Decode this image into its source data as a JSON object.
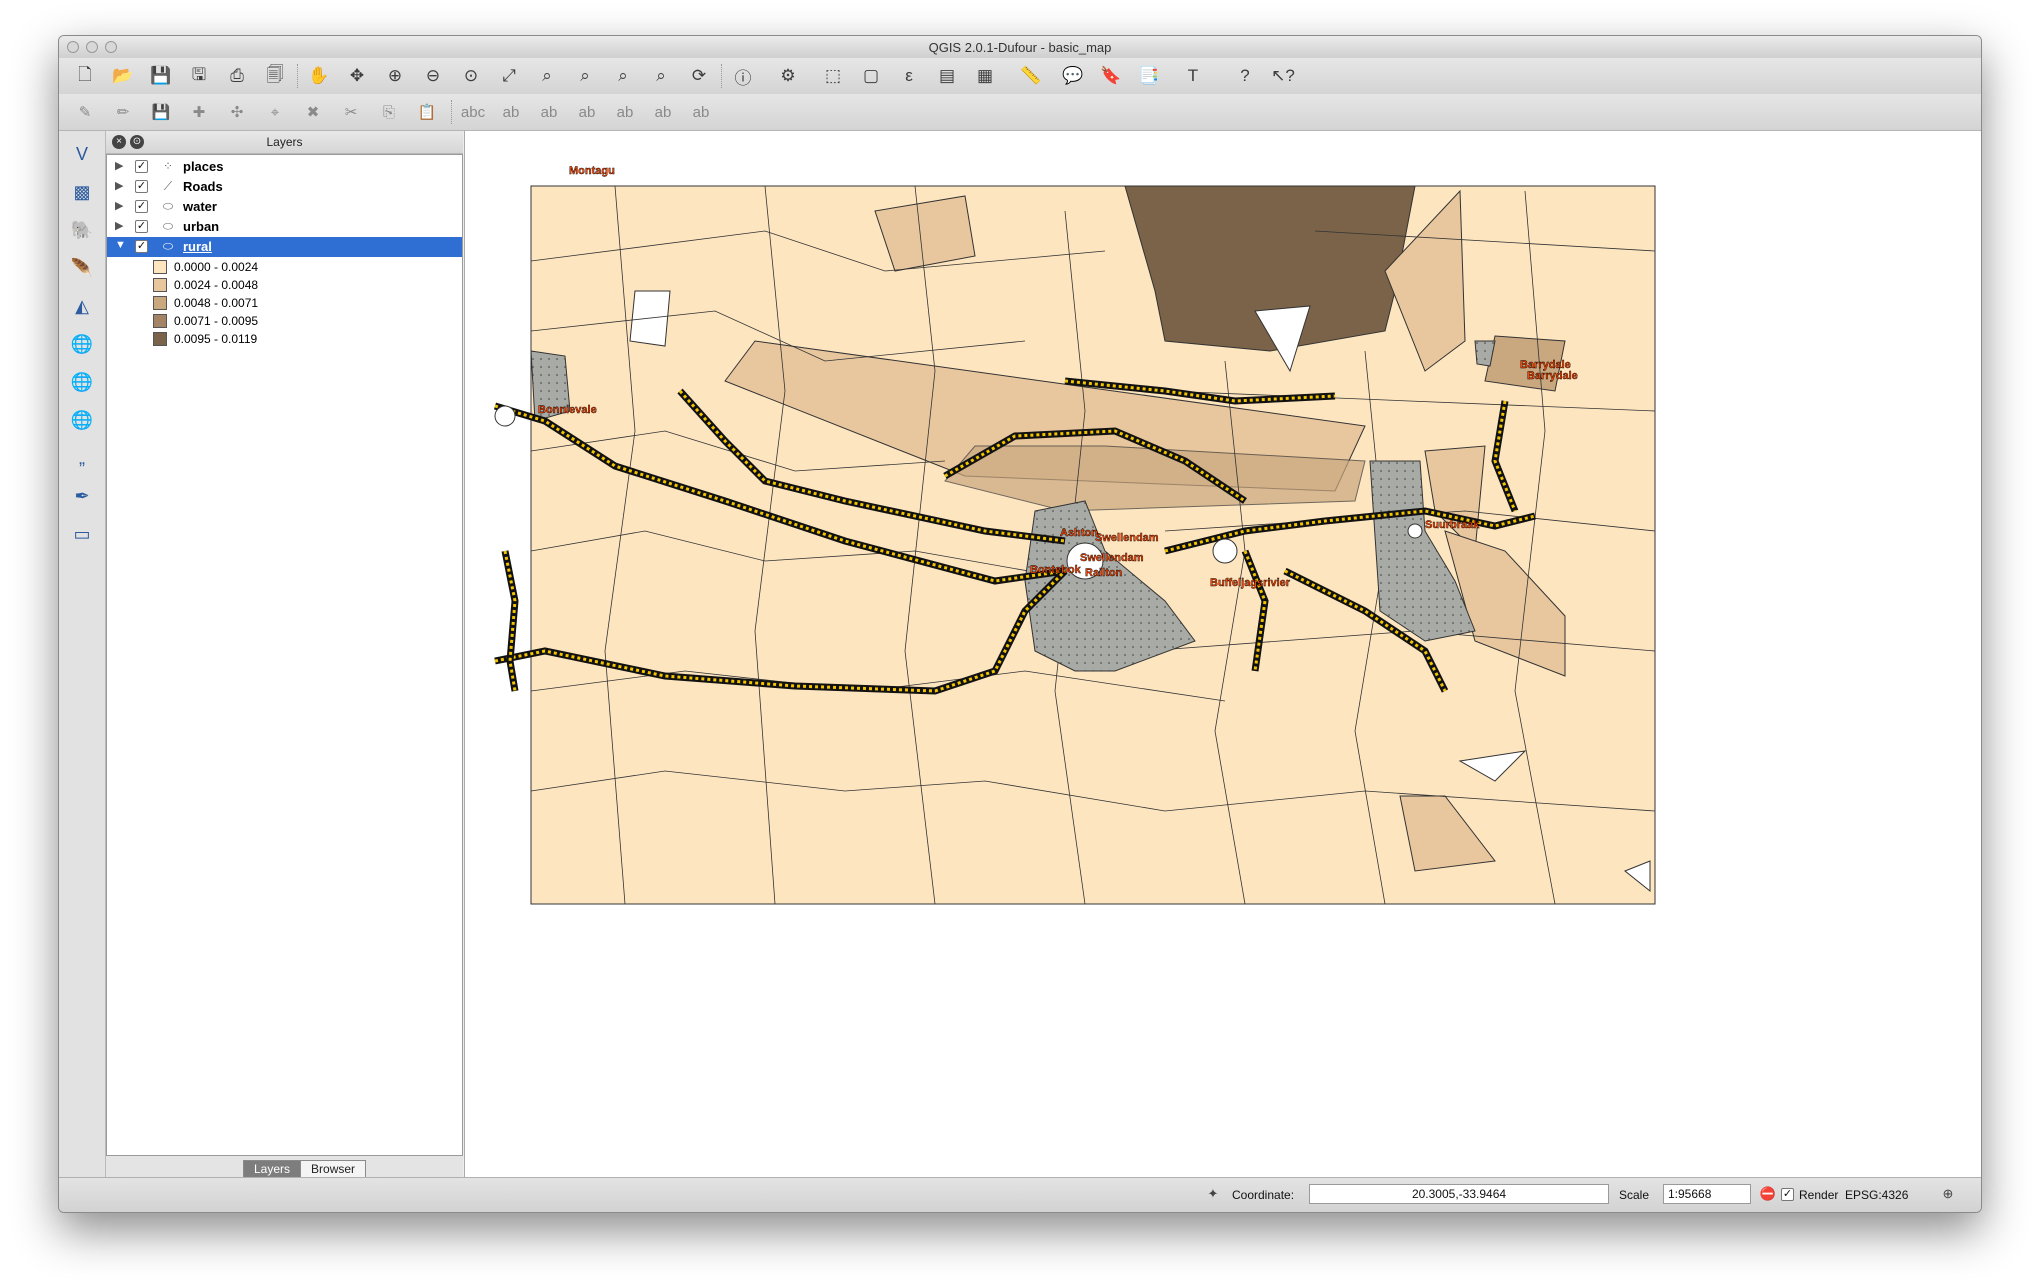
{
  "window": {
    "title": "QGIS 2.0.1-Dufour - basic_map"
  },
  "toolbar_main": {
    "icons": [
      "new-project-icon",
      "open-project-icon",
      "save-project-icon",
      "save-as-icon",
      "new-print-composer-icon",
      "composer-manager-icon",
      "pan-icon",
      "pan-to-selection-icon",
      "zoom-in-icon",
      "zoom-out-icon",
      "zoom-actual-size-icon",
      "zoom-full-icon",
      "zoom-to-selection-icon",
      "zoom-to-layer-icon",
      "zoom-last-icon",
      "zoom-next-icon",
      "refresh-icon",
      "identify-icon",
      "action-icon",
      "select-icon",
      "deselect-icon",
      "field-calculator-icon",
      "attribute-table-icon",
      "statistics-icon",
      "measure-icon",
      "map-tips-icon",
      "new-bookmark-icon",
      "show-bookmarks-icon",
      "text-annotation-icon",
      "help-icon",
      "whats-this-icon"
    ]
  },
  "toolbar_edit": {
    "icons": [
      "current-edits-icon",
      "toggle-editing-icon",
      "save-edits-icon",
      "add-feature-icon",
      "move-feature-icon",
      "node-tool-icon",
      "delete-selected-icon",
      "cut-features-icon",
      "copy-features-icon",
      "paste-features-icon",
      "label-icon",
      "label-pin-icon",
      "label-highlight-icon",
      "label-show-hide-icon",
      "label-move-icon",
      "label-rotate-icon",
      "label-change-icon"
    ]
  },
  "left_toolbar": {
    "icons": [
      "add-vector-layer-icon",
      "add-raster-layer-icon",
      "add-postgis-layer-icon",
      "add-spatialite-layer-icon",
      "add-mssql-layer-icon",
      "add-wms-layer-icon",
      "add-wcs-layer-icon",
      "add-wfs-layer-icon",
      "add-delimited-text-icon",
      "new-shapefile-icon",
      "remove-layer-icon"
    ]
  },
  "layers_panel": {
    "title": "Layers",
    "layers": [
      {
        "name": "places",
        "checked": true,
        "selected": false,
        "icon": "point-layer-icon"
      },
      {
        "name": "Roads",
        "checked": true,
        "selected": false,
        "icon": "line-layer-icon"
      },
      {
        "name": "water",
        "checked": true,
        "selected": false,
        "icon": "polygon-layer-icon"
      },
      {
        "name": "urban",
        "checked": true,
        "selected": false,
        "icon": "polygon-layer-icon"
      },
      {
        "name": "rural",
        "checked": true,
        "selected": true,
        "icon": "polygon-layer-icon"
      }
    ],
    "legend": [
      {
        "label": "0.0000 - 0.0024",
        "color": "#fde5c0"
      },
      {
        "label": "0.0024 - 0.0048",
        "color": "#e8c79e"
      },
      {
        "label": "0.0048 - 0.0071",
        "color": "#c9a77f"
      },
      {
        "label": "0.0071 - 0.0095",
        "color": "#a38566"
      },
      {
        "label": "0.0095 - 0.0119",
        "color": "#7a6348"
      }
    ],
    "tabs": [
      "Layers",
      "Browser"
    ]
  },
  "map": {
    "labels": [
      "Montagu",
      "Bonnievale",
      "Barrydale",
      "Barrydale",
      "Suurbraak",
      "Buffeljagsrivier",
      "Swellendam",
      "Railton",
      "Ashton",
      "Swellendam",
      "Bontebok"
    ],
    "colors": {
      "rural_base": "#fde5c0",
      "road_casing": "#111111",
      "road_fill": "#f2c500",
      "water": "#a7aaa5",
      "label_text": "#ff4500"
    }
  },
  "statusbar": {
    "coordinate_label": "Coordinate:",
    "coordinate_value": "20.3005,-33.9464",
    "scale_label": "Scale",
    "scale_value": "1:95668",
    "render_label": "Render",
    "crs_label": "EPSG:4326"
  }
}
